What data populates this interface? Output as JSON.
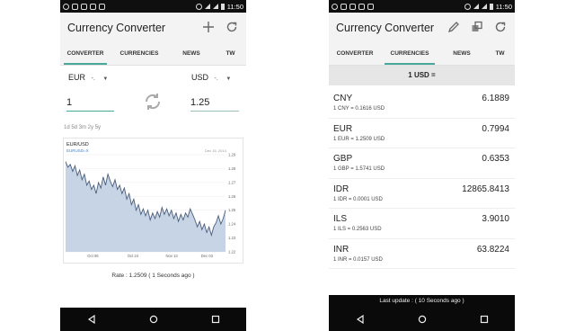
{
  "status": {
    "time": "11:50"
  },
  "left": {
    "title": "Currency Converter",
    "actions": [
      "add-icon",
      "refresh-icon"
    ],
    "tabs": [
      "CONVERTER",
      "CURRENCIES",
      "NEWS",
      "TW"
    ],
    "from_currency": "EUR",
    "to_currency": "USD",
    "caret_suffix": "-.",
    "from_amount": "1",
    "to_amount": "1.25",
    "ranges": "1d 5d 3m 2y 5y",
    "chart": {
      "pair_label": "EUR/USD",
      "symbol": "EURUSD=X",
      "date_label": "Dec 16, 2014",
      "source": "© Yahoo!",
      "accent": "#4aa89a"
    },
    "rate_text": "Rate : 1.2509 ( 1 Seconds ago )"
  },
  "right": {
    "title": "Currency Converter",
    "actions": [
      "pencil-icon",
      "copy-icon",
      "refresh-icon"
    ],
    "tabs": [
      "CONVERTER",
      "CURRENCIES",
      "NEWS",
      "TW"
    ],
    "base_header": "1 USD =",
    "rates": [
      {
        "code": "CNY",
        "value": "6.1889",
        "sub": "1 CNY = 0.1616 USD"
      },
      {
        "code": "EUR",
        "value": "0.7994",
        "sub": "1 EUR = 1.2509 USD"
      },
      {
        "code": "GBP",
        "value": "0.6353",
        "sub": "1 GBP = 1.5741 USD"
      },
      {
        "code": "IDR",
        "value": "12865.8413",
        "sub": "1 IDR = 0.0001 USD"
      },
      {
        "code": "ILS",
        "value": "3.9010",
        "sub": "1 ILS = 0.2563 USD"
      },
      {
        "code": "INR",
        "value": "63.8224",
        "sub": "1 INR = 0.0157 USD"
      }
    ],
    "last_update": "Last update : ( 10 Seconds ago )"
  },
  "chart_data": {
    "type": "line",
    "title": "EUR/USD",
    "subtitle": "EURUSD=X",
    "xlabel": "",
    "ylabel": "",
    "x_ticks": [
      "Oct 06",
      "Oct 24",
      "Nov 13",
      "Dec 03"
    ],
    "y_ticks": [
      1.22,
      1.23,
      1.24,
      1.25,
      1.26,
      1.27,
      1.28,
      1.29
    ],
    "ylim": [
      1.22,
      1.29
    ],
    "series": [
      {
        "values": [
          1.285,
          1.281,
          1.283,
          1.278,
          1.282,
          1.275,
          1.279,
          1.272,
          1.276,
          1.268,
          1.271,
          1.265,
          1.268,
          1.262,
          1.27,
          1.266,
          1.274,
          1.268,
          1.276,
          1.271,
          1.267,
          1.272,
          1.265,
          1.268,
          1.262,
          1.266,
          1.258,
          1.262,
          1.254,
          1.258,
          1.25,
          1.254,
          1.247,
          1.251,
          1.246,
          1.25,
          1.243,
          1.248,
          1.244,
          1.249,
          1.245,
          1.252,
          1.247,
          1.251,
          1.246,
          1.25,
          1.244,
          1.248,
          1.242,
          1.247,
          1.243,
          1.248,
          1.245,
          1.251,
          1.247,
          1.243,
          1.238,
          1.242,
          1.236,
          1.24,
          1.234,
          1.238,
          1.232,
          1.238,
          1.241,
          1.246,
          1.24,
          1.244,
          1.25
        ]
      }
    ]
  }
}
